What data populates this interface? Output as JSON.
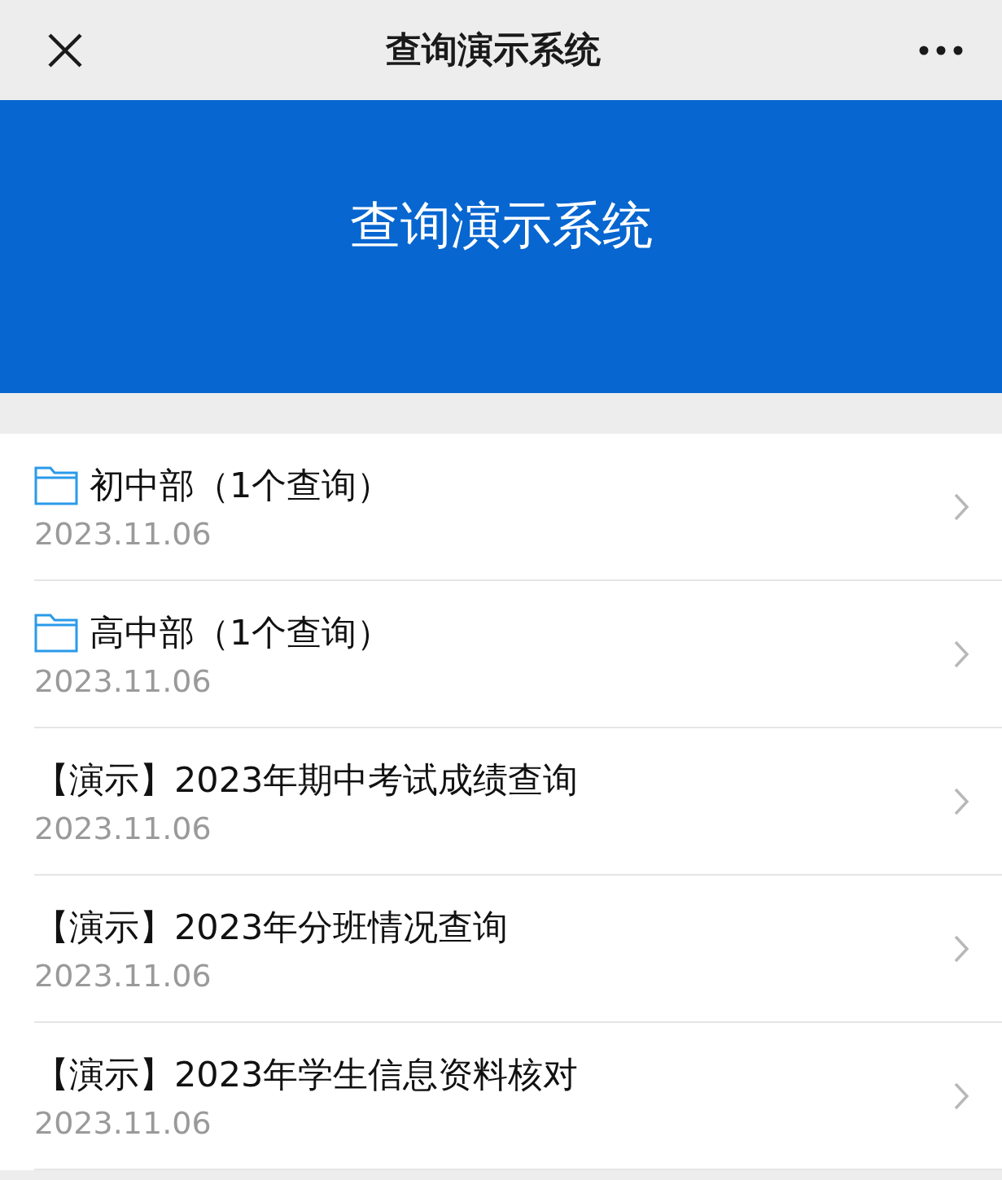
{
  "nav_bar": {
    "title": "查询演示系统"
  },
  "banner": {
    "title": "查询演示系统"
  },
  "items": [
    {
      "kind": "folder",
      "title": "初中部（1个查询）",
      "date": "2023.11.06"
    },
    {
      "kind": "folder",
      "title": "高中部（1个查询）",
      "date": "2023.11.06"
    },
    {
      "kind": "query",
      "title": "【演示】2023年期中考试成绩查询",
      "date": "2023.11.06"
    },
    {
      "kind": "query",
      "title": "【演示】2023年分班情况查询",
      "date": "2023.11.06"
    },
    {
      "kind": "query",
      "title": "【演示】2023年学生信息资料核对",
      "date": "2023.11.06"
    }
  ]
}
